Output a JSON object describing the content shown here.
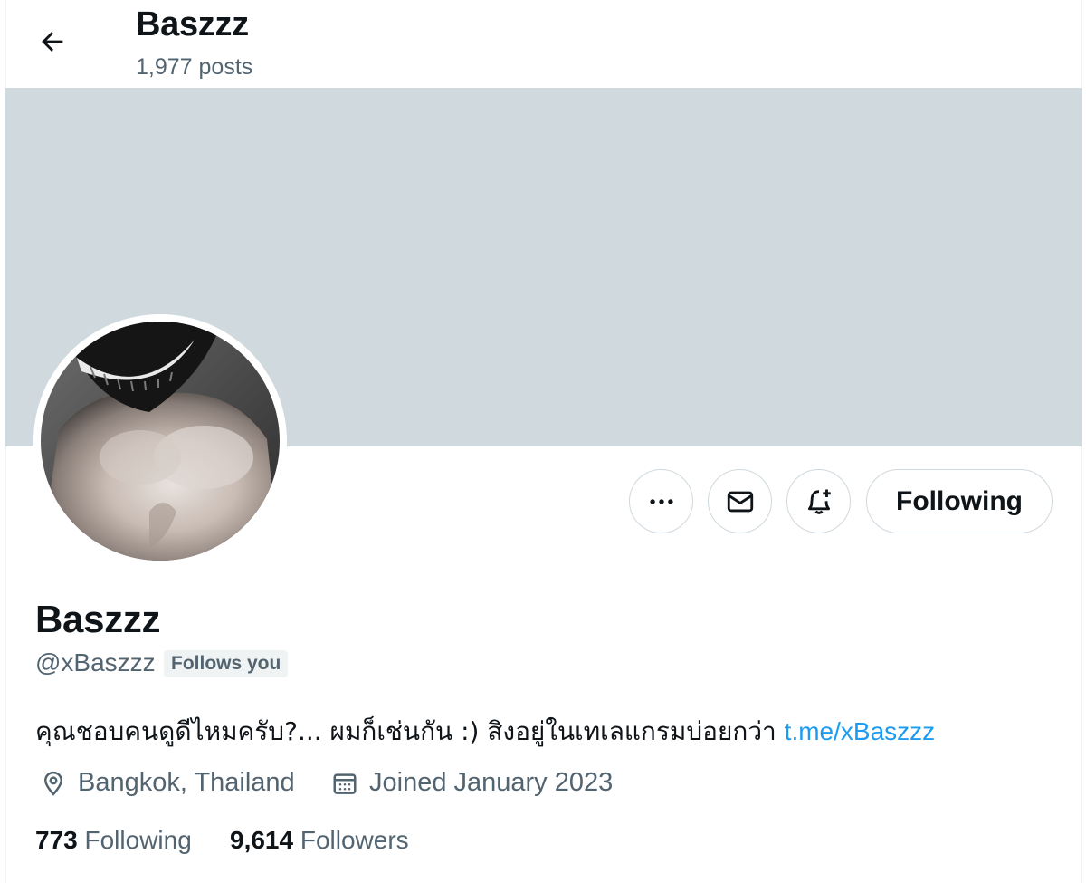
{
  "header": {
    "title": "Baszzz",
    "posts_count": "1,977 posts"
  },
  "profile": {
    "display_name": "Baszzz",
    "handle": "@xBaszzz",
    "follows_you_badge": "Follows you",
    "bio_text": "คุณชอบคนดูดีไหมครับ?... ผมก็เช่นกัน :) สิงอยู่ในเทเลแกรมบ่อยกว่า ",
    "bio_link": "t.me/xBaszzz",
    "location": "Bangkok, Thailand",
    "joined": "Joined January 2023"
  },
  "actions": {
    "following_label": "Following"
  },
  "stats": {
    "following_count": "773",
    "following_label": "Following",
    "followers_count": "9,614",
    "followers_label": "Followers"
  },
  "icons": {
    "back": "arrow-left-icon",
    "more": "more-icon",
    "message": "envelope-icon",
    "notify": "bell-plus-icon",
    "location": "location-pin-icon",
    "calendar": "calendar-icon"
  },
  "colors": {
    "banner": "#cfd9de",
    "link": "#1d9bf0",
    "secondary_text": "#536471",
    "primary_text": "#0f1419"
  }
}
